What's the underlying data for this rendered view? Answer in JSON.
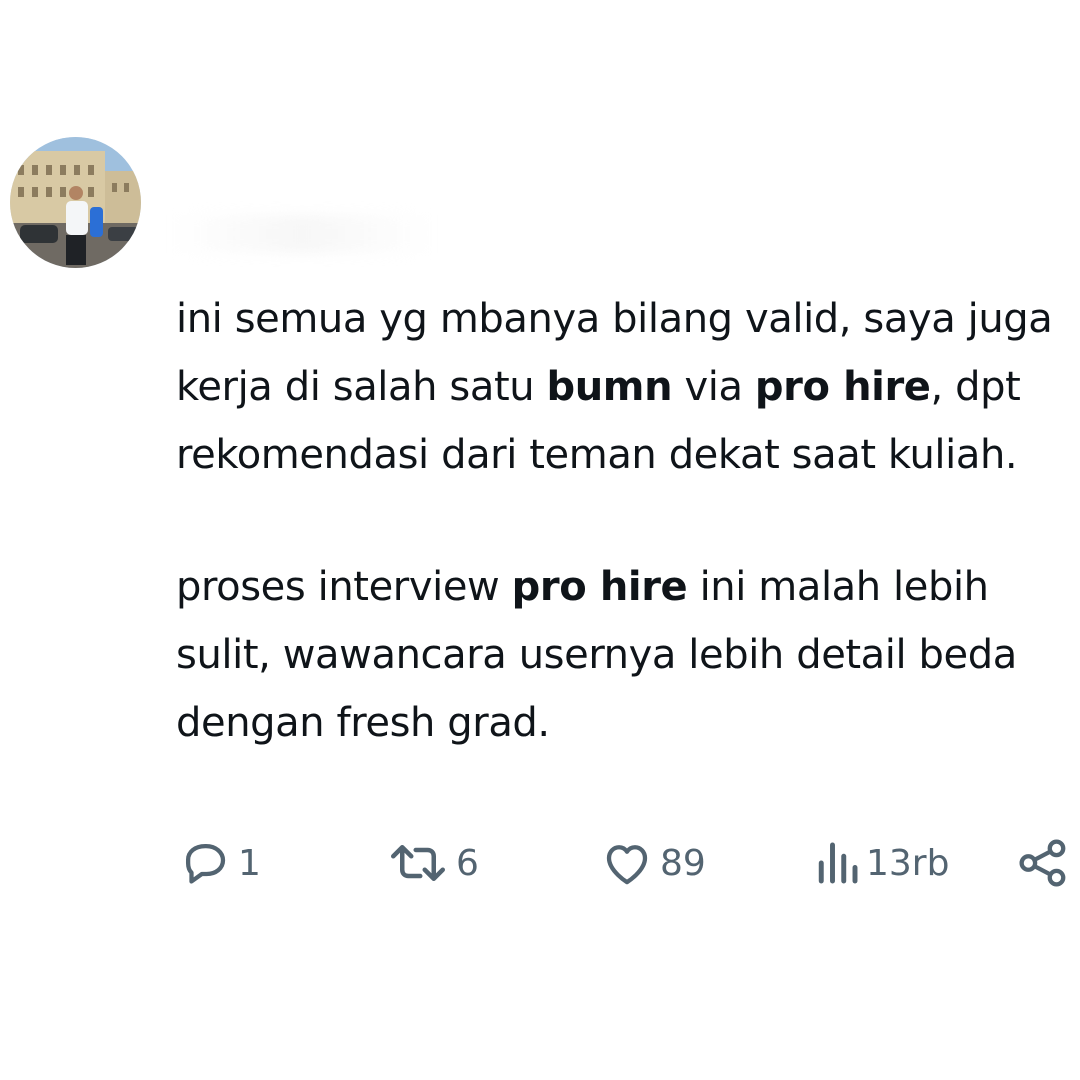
{
  "tweet": {
    "paragraphs": [
      [
        {
          "text": "ini semua yg mbanya bilang valid, saya juga kerja di salah satu ",
          "bold": false
        },
        {
          "text": "bumn",
          "bold": true
        },
        {
          "text": " via ",
          "bold": false
        },
        {
          "text": "pro hire",
          "bold": true
        },
        {
          "text": ", dpt rekomendasi dari teman dekat saat kuliah.",
          "bold": false
        }
      ],
      [
        {
          "text": "proses interview ",
          "bold": false
        },
        {
          "text": "pro hire",
          "bold": true
        },
        {
          "text": " ini malah lebih sulit, wawancara usernya lebih detail beda dengan fresh grad.",
          "bold": false
        }
      ]
    ]
  },
  "actions": {
    "reply": {
      "icon": "reply-icon",
      "count": "1"
    },
    "retweet": {
      "icon": "retweet-icon",
      "count": "6"
    },
    "like": {
      "icon": "heart-icon",
      "count": "89"
    },
    "views": {
      "icon": "views-icon",
      "count": "13rb"
    },
    "share": {
      "icon": "share-icon"
    }
  },
  "colors": {
    "text": "#0f1419",
    "icon": "#536471",
    "background": "#ffffff"
  }
}
